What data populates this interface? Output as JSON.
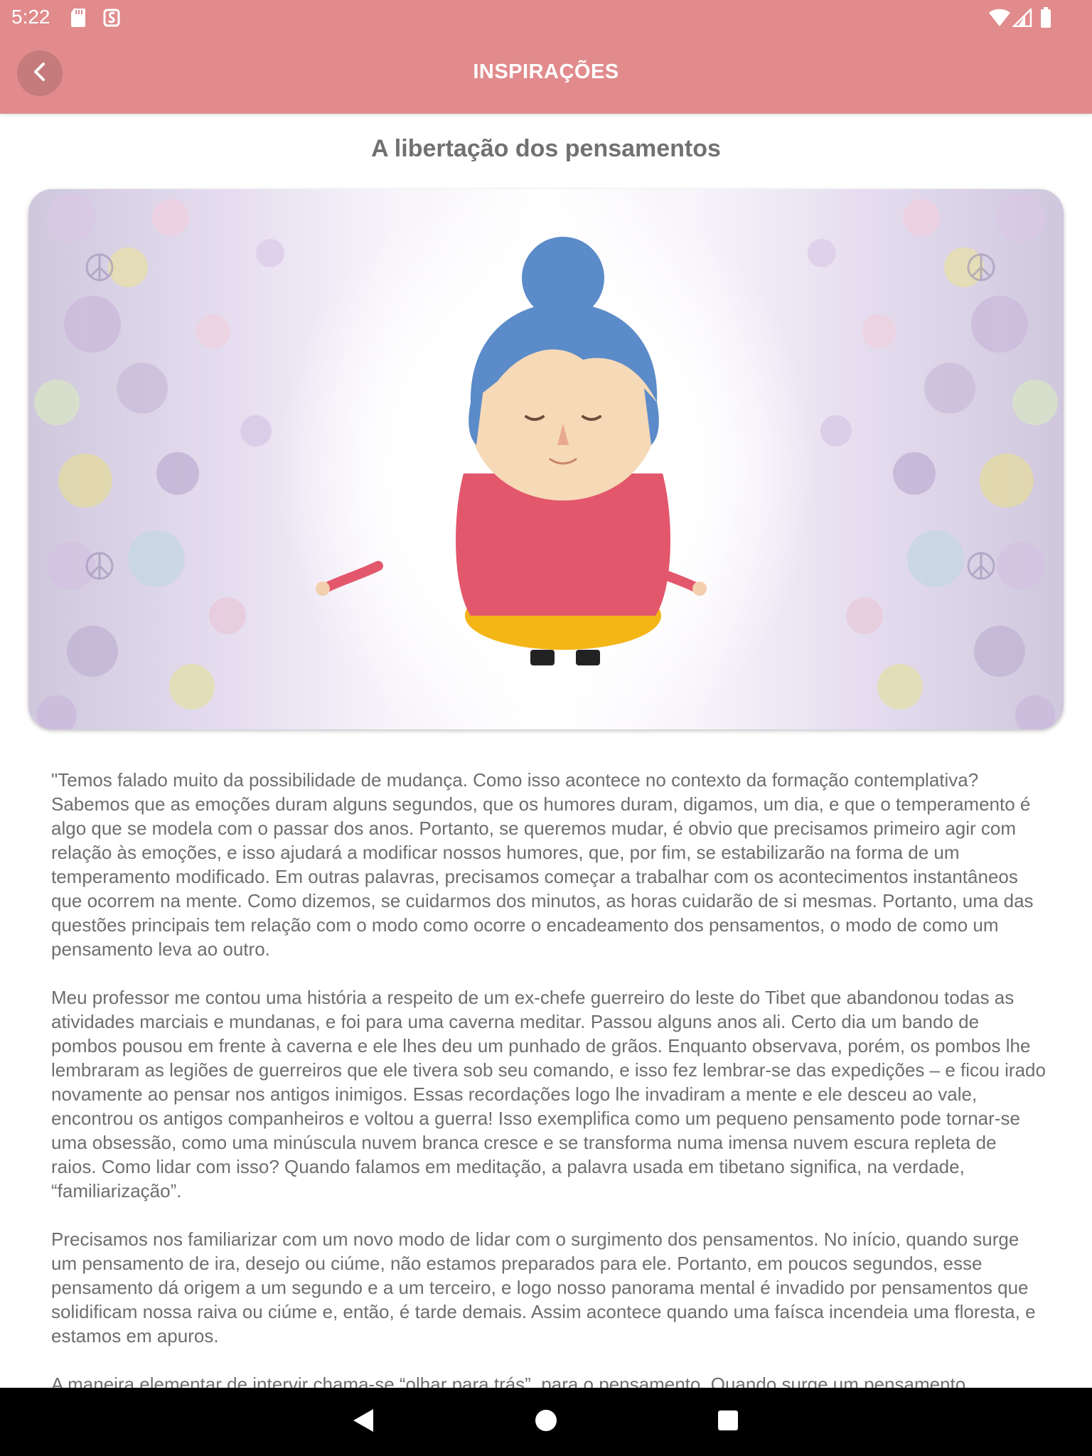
{
  "status_bar": {
    "time": "5:22",
    "icons_left": [
      "sd-card-icon",
      "subscription-icon"
    ],
    "icons_right": [
      "wifi-icon",
      "signal-icon",
      "battery-icon"
    ]
  },
  "app_bar": {
    "title": "INSPIRAÇÕES",
    "back_icon": "chevron-left-icon",
    "background_color": "#e18b8d"
  },
  "article": {
    "title": "A libertação dos pensamentos",
    "image": "meditating-character-illustration",
    "paragraphs": [
      "\"Temos falado muito da possibilidade de mudança. Como isso acontece no contexto da formação contemplativa? Sabemos que as emoções duram alguns segundos, que os humores duram, digamos, um dia, e que o temperamento é algo que se modela com o passar dos anos. Portanto, se queremos mudar, é obvio que precisamos primeiro agir com relação às emoções, e isso ajudará a modificar nossos humores, que, por fim, se estabilizarão na forma de um temperamento modificado. Em outras palavras, precisamos começar a trabalhar com os acontecimentos instantâneos que ocorrem na mente. Como dizemos, se cuidarmos dos minutos, as horas cuidarão de si mesmas. Portanto, uma das questões principais tem relação com o modo como ocorre o encadeamento dos pensamentos, o modo de como um pensamento leva ao outro.",
      "Meu professor me contou uma história a respeito de um ex-chefe guerreiro do leste do Tibet que abandonou todas as atividades marciais e mundanas, e foi para uma caverna meditar. Passou alguns anos ali. Certo dia um bando de pombos pousou em frente à caverna e ele lhes deu um punhado de grãos. Enquanto observava, porém, os pombos lhe lembraram as legiões de guerreiros que ele tivera sob seu comando, e isso fez lembrar-se das expedições – e ficou irado novamente ao pensar nos antigos inimigos. Essas recordações logo lhe invadiram a mente e ele desceu ao vale, encontrou os antigos companheiros e voltou a guerra! Isso exemplifica como um pequeno pensamento pode tornar-se uma obsessão, como uma minúscula nuvem branca cresce e se transforma numa imensa nuvem escura repleta de raios. Como lidar com isso? Quando falamos em meditação, a palavra usada em tibetano significa, na verdade, “familiarização”.",
      "Precisamos nos familiarizar com um novo modo de lidar com o surgimento dos pensamentos. No início, quando surge um pensamento de ira, desejo ou ciúme, não estamos preparados para ele. Portanto, em poucos segundos, esse pensamento dá origem a um segundo e a um terceiro, e logo nosso panorama mental é invadido por pensamentos que solidificam nossa raiva ou ciúme e, então, é tarde demais. Assim acontece quando uma faísca incendeia uma floresta, e estamos em apuros.",
      "A maneira elementar de intervir chama-se “olhar para trás”, para o pensamento. Quando surge um pensamento"
    ]
  },
  "nav_bar": {
    "buttons": [
      "back-triangle-icon",
      "home-circle-icon",
      "recents-square-icon"
    ]
  }
}
